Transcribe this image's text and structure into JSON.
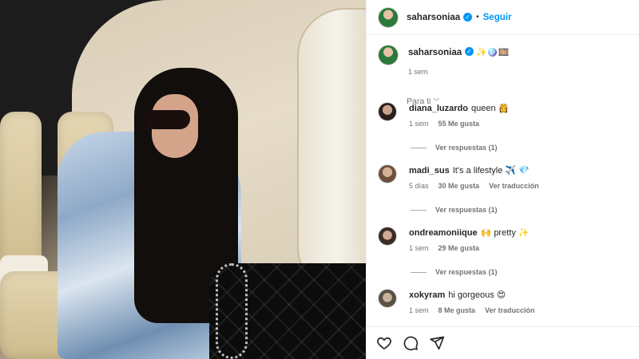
{
  "post": {
    "username": "saharsoniaa",
    "follow_label": "Seguir",
    "caption_emoji": "✨🪩🎞️",
    "caption_time": "1 sem"
  },
  "sort_label": "Para ti",
  "comments": [
    {
      "username": "diana_luzardo",
      "text": "queen 👸",
      "time": "1 sem",
      "likes": "55 Me gusta",
      "translate": "",
      "replies": "Ver respuestas (1)"
    },
    {
      "username": "madi_sus",
      "text": "It's a lifestyle ✈️ 💎",
      "time": "5 días",
      "likes": "30 Me gusta",
      "translate": "Ver traducción",
      "replies": "Ver respuestas (1)"
    },
    {
      "username": "ondreamoniique",
      "text": "🙌 pretty ✨",
      "time": "1 sem",
      "likes": "29 Me gusta",
      "translate": "",
      "replies": "Ver respuestas (1)"
    },
    {
      "username": "xokyram",
      "text": "hi gorgeous 😍",
      "time": "1 sem",
      "likes": "8 Me gusta",
      "translate": "Ver traducción",
      "replies": ""
    }
  ],
  "actions": {
    "like_icon": "heart-icon",
    "comment_icon": "comment-icon",
    "share_icon": "send-icon"
  }
}
